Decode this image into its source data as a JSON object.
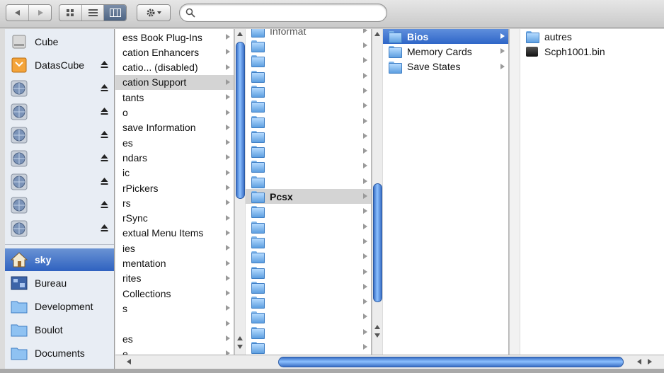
{
  "toolbar": {
    "nav": [
      "back-icon",
      "forward-icon"
    ],
    "views": [
      "icon-view-icon",
      "list-view-icon",
      "column-view-icon"
    ],
    "selected_view": "column-view-icon",
    "action": "gear-icon",
    "search_placeholder": ""
  },
  "sidebar": {
    "devices": [
      {
        "label": "Cube",
        "icon": "hard-disk-icon",
        "eject": false
      },
      {
        "label": "DatasCube",
        "icon": "drive-icon",
        "eject": true
      },
      {
        "label": "",
        "icon": "network-volume-icon",
        "eject": true
      },
      {
        "label": "",
        "icon": "network-volume-icon",
        "eject": true
      },
      {
        "label": "",
        "icon": "network-volume-icon",
        "eject": true
      },
      {
        "label": "",
        "icon": "network-volume-icon",
        "eject": true
      },
      {
        "label": "",
        "icon": "network-volume-icon",
        "eject": true
      },
      {
        "label": "",
        "icon": "network-volume-icon",
        "eject": true
      },
      {
        "label": "",
        "icon": "network-volume-icon",
        "eject": true
      }
    ],
    "places": [
      {
        "label": "sky",
        "icon": "home-icon",
        "selected": true
      },
      {
        "label": "Bureau",
        "icon": "desktop-icon",
        "selected": false
      },
      {
        "label": "Development",
        "icon": "folder-icon",
        "selected": false
      },
      {
        "label": "Boulot",
        "icon": "folder-icon",
        "selected": false
      },
      {
        "label": "Documents",
        "icon": "folder-icon",
        "selected": false
      }
    ]
  },
  "column1": {
    "items": [
      "ess Book Plug-Ins",
      "cation Enhancers",
      "catio... (disabled)",
      "cation Support",
      "tants",
      "o",
      "save Information",
      "es",
      "ndars",
      "ic",
      "rPickers",
      "rs",
      "rSync",
      "extual Menu Items",
      "ies",
      "mentation",
      "rites",
      "Collections",
      "s",
      "",
      "es",
      "e"
    ],
    "selected_index": 3
  },
  "column2": {
    "top_partial": "Informat",
    "selected_label": "Pcsx",
    "selected_index": 10
  },
  "column3": {
    "items": [
      "Bios",
      "Memory Cards",
      "Save States"
    ],
    "selected_index": 0
  },
  "column4": {
    "items": [
      {
        "label": "autres",
        "icon": "folder-icon"
      },
      {
        "label": "Scph1001.bin",
        "icon": "binary-file-icon"
      }
    ]
  },
  "colors": {
    "selection_blue": "#2f66c8",
    "selection_gray": "#d4d4d4",
    "sidebar_bg": "#e8edf4"
  }
}
